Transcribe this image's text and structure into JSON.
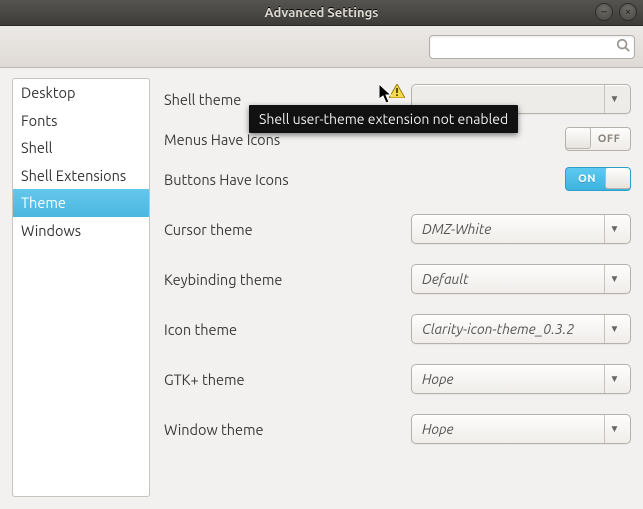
{
  "window": {
    "title": "Advanced Settings"
  },
  "search": {
    "placeholder": ""
  },
  "sidebar": {
    "items": [
      {
        "label": "Desktop"
      },
      {
        "label": "Fonts"
      },
      {
        "label": "Shell"
      },
      {
        "label": "Shell Extensions"
      },
      {
        "label": "Theme",
        "selected": true
      },
      {
        "label": "Windows"
      }
    ]
  },
  "settings": {
    "shell_theme": {
      "label": "Shell theme",
      "value": "",
      "disabled": true
    },
    "menus_have_icons": {
      "label": "Menus Have Icons",
      "state": "OFF"
    },
    "buttons_have_icons": {
      "label": "Buttons Have Icons",
      "state": "ON"
    },
    "cursor_theme": {
      "label": "Cursor theme",
      "value": "DMZ-White"
    },
    "keybinding_theme": {
      "label": "Keybinding theme",
      "value": "Default"
    },
    "icon_theme": {
      "label": "Icon theme",
      "value": "Clarity-icon-theme_0.3.2"
    },
    "gtk_theme": {
      "label": "GTK+ theme",
      "value": "Hope"
    },
    "window_theme": {
      "label": "Window theme",
      "value": "Hope"
    }
  },
  "tooltip": {
    "text": "Shell user-theme extension not enabled"
  }
}
